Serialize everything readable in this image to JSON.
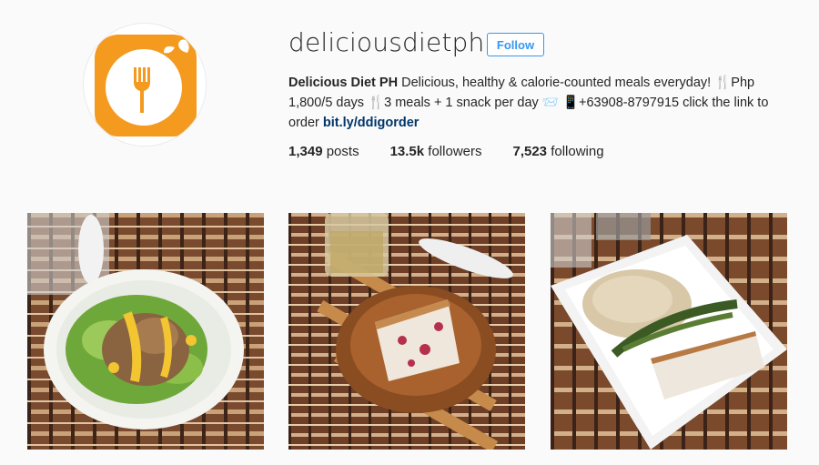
{
  "profile": {
    "username": "deliciousdietph",
    "follow_label": "Follow",
    "display_name": "Delicious Diet PH",
    "bio_1": " Delicious, healthy & calorie-counted meals everyday! ",
    "pin_1": "🍴",
    "bio_2": "Php 1,800/5 days ",
    "pin_2": "🍴",
    "bio_3": "3 meals + 1 snack per day ",
    "mail_icon": "📨",
    "phone_icon": "📱",
    "bio_4": "+63908-8797915 click the link to order ",
    "link": "bit.ly/ddigorder",
    "logo_icon": "fork-logo-icon"
  },
  "stats": {
    "posts_count": "1,349",
    "posts_label": "posts",
    "followers_count": "13.5k",
    "followers_label": "followers",
    "following_count": "7,523",
    "following_label": "following"
  },
  "colors": {
    "brand_orange": "#f39a1f",
    "follow_blue": "#3897f0",
    "link_blue": "#003569"
  }
}
